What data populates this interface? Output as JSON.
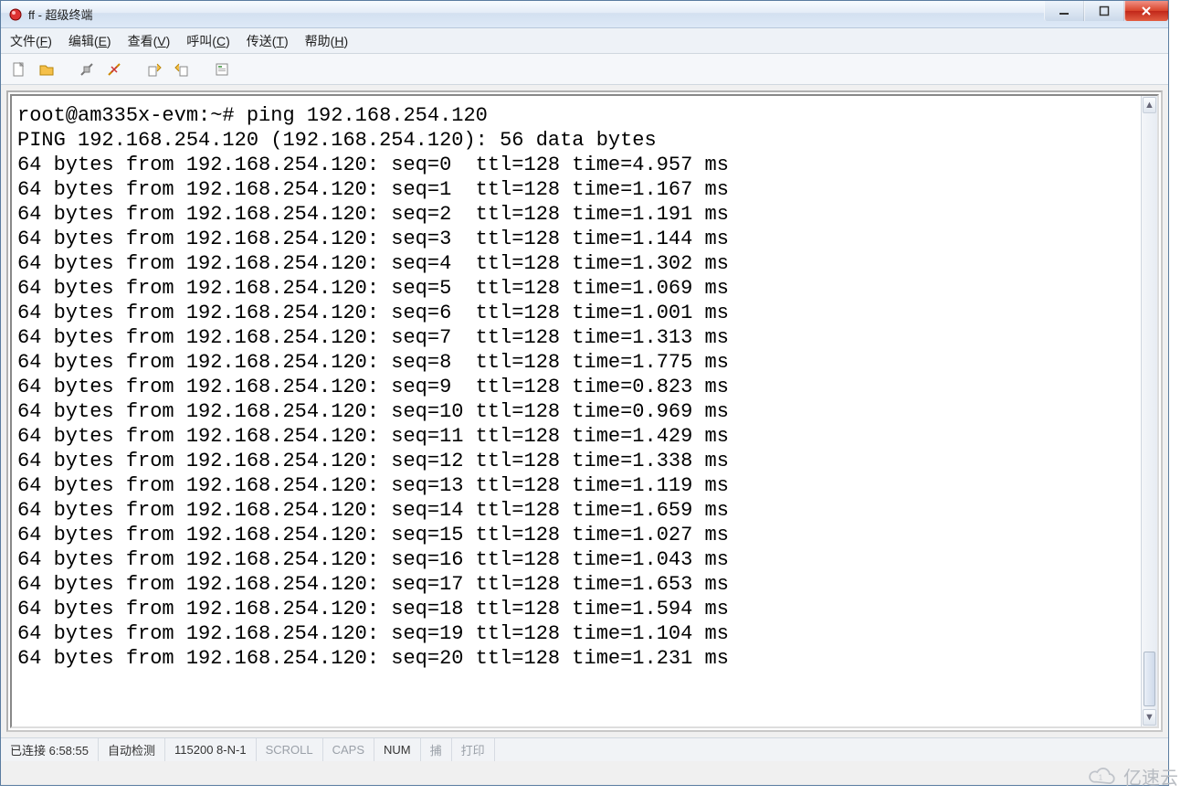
{
  "window": {
    "title": "ff - 超级终端"
  },
  "menubar": [
    {
      "label": "文件",
      "accel": "F"
    },
    {
      "label": "编辑",
      "accel": "E"
    },
    {
      "label": "查看",
      "accel": "V"
    },
    {
      "label": "呼叫",
      "accel": "C"
    },
    {
      "label": "传送",
      "accel": "T"
    },
    {
      "label": "帮助",
      "accel": "H"
    }
  ],
  "toolbar": {
    "icons": [
      "new-file",
      "open-file",
      "spacer",
      "connect",
      "disconnect",
      "spacer",
      "send",
      "receive",
      "spacer",
      "properties"
    ]
  },
  "terminal": {
    "prompt": "root@am335x-evm:~# ping 192.168.254.120",
    "header": "PING 192.168.254.120 (192.168.254.120): 56 data bytes",
    "host": "192.168.254.120",
    "bytes": 64,
    "ttl": 128,
    "replies": [
      {
        "seq": 0,
        "time": "4.957"
      },
      {
        "seq": 1,
        "time": "1.167"
      },
      {
        "seq": 2,
        "time": "1.191"
      },
      {
        "seq": 3,
        "time": "1.144"
      },
      {
        "seq": 4,
        "time": "1.302"
      },
      {
        "seq": 5,
        "time": "1.069"
      },
      {
        "seq": 6,
        "time": "1.001"
      },
      {
        "seq": 7,
        "time": "1.313"
      },
      {
        "seq": 8,
        "time": "1.775"
      },
      {
        "seq": 9,
        "time": "0.823"
      },
      {
        "seq": 10,
        "time": "0.969"
      },
      {
        "seq": 11,
        "time": "1.429"
      },
      {
        "seq": 12,
        "time": "1.338"
      },
      {
        "seq": 13,
        "time": "1.119"
      },
      {
        "seq": 14,
        "time": "1.659"
      },
      {
        "seq": 15,
        "time": "1.027"
      },
      {
        "seq": 16,
        "time": "1.043"
      },
      {
        "seq": 17,
        "time": "1.653"
      },
      {
        "seq": 18,
        "time": "1.594"
      },
      {
        "seq": 19,
        "time": "1.104"
      },
      {
        "seq": 20,
        "time": "1.231"
      }
    ]
  },
  "statusbar": {
    "connection": "已连接 6:58:55",
    "detect": "自动检测",
    "serial": "115200 8-N-1",
    "scroll": "SCROLL",
    "caps": "CAPS",
    "num": "NUM",
    "capture": "捕",
    "print": "打印"
  },
  "watermark": {
    "text": "亿速云"
  }
}
